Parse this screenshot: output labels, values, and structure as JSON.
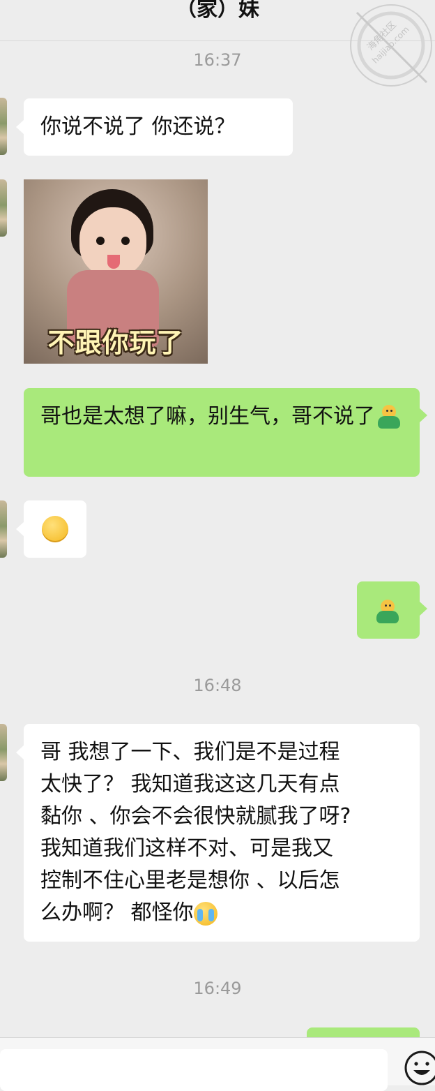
{
  "header": {
    "title": "（家）妹"
  },
  "watermark": {
    "line1": "海角社区",
    "line2": "haijiao.com"
  },
  "messages": {
    "ts1": "16:37",
    "m1": "你说不说了 你还说？",
    "sticker_caption": "不跟你玩了",
    "m3": "哥也是太想了嘛，别生气，哥不说了",
    "ts2": "16:48",
    "m6_line1": "哥 我想了一下、我们是不是过程",
    "m6_line2": "太快了？  我知道我这这几天有点",
    "m6_line3": "黏你 、你会不会很快就腻我了呀?",
    "m6_line4": " 我知道我们这样不对、可是我又",
    "m6_line5": "控制不住心里老是想你 、以后怎",
    "m6_line6": "么办啊？ 都怪你",
    "ts3": "16:49"
  },
  "icons": {
    "green_emoji": "green-figure-emoji",
    "tongue_emoji": "tongue-out-emoji",
    "cry_emoji": "crying-emoji",
    "input_emoji": "smiley-face-icon"
  },
  "colors": {
    "background": "#ededed",
    "incoming_bubble": "#ffffff",
    "outgoing_bubble": "#a9e97b",
    "timestamp": "#9a9a9a"
  }
}
